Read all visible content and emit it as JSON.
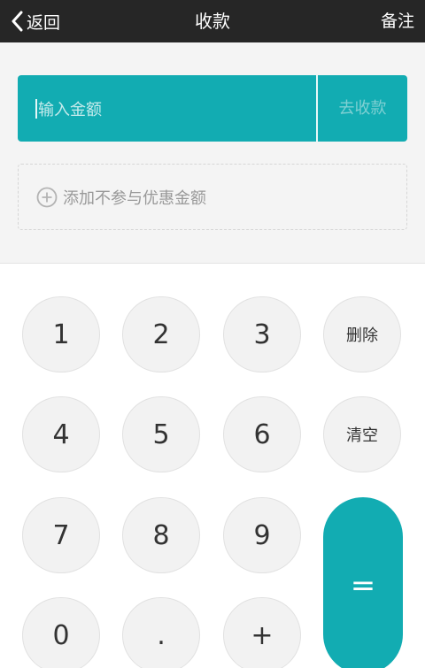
{
  "header": {
    "back_label": "返回",
    "title": "收款",
    "note_label": "备注"
  },
  "amount": {
    "placeholder": "输入金额",
    "collect_label": "去收款"
  },
  "discount": {
    "label": "添加不参与优惠金额"
  },
  "keypad": {
    "k1": "1",
    "k2": "2",
    "k3": "3",
    "delete": "删除",
    "k4": "4",
    "k5": "5",
    "k6": "6",
    "clear": "清空",
    "k7": "7",
    "k8": "8",
    "k9": "9",
    "equals": "=",
    "k0": "0",
    "dot": ".",
    "plus": "+"
  },
  "colors": {
    "accent": "#12acb2",
    "topbar": "#262626",
    "background": "#f4f4f4"
  }
}
